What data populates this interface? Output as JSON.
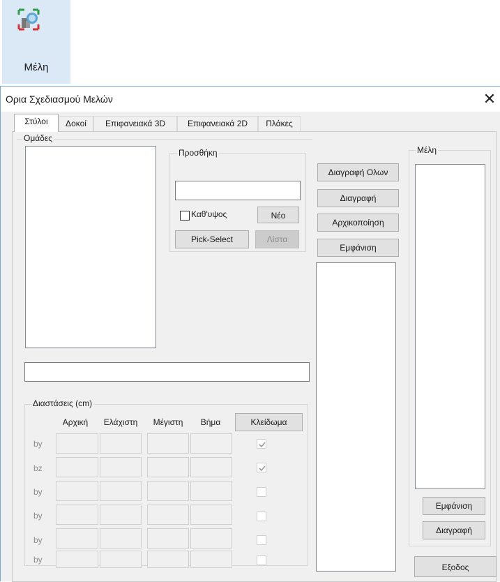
{
  "ribbon": {
    "label": "Μέλη",
    "icon": "members-icon"
  },
  "dialog": {
    "title": "Ορια Σχεδιασμού Μελών",
    "tabs": [
      "Στύλοι",
      "Δοκοί",
      "Επιφανειακά 3D",
      "Επιφανειακά 2D",
      "Πλάκες"
    ],
    "groups_label": "Ομάδες",
    "add_label": "Προσθήκη",
    "add_value": "",
    "by_height_label": "Καθ'υψος",
    "new_button": "Νέο",
    "pick_select_button": "Pick-Select",
    "list_button": "Λίστα",
    "group_name_value": "",
    "delete_all_button": "Διαγραφή Ολων",
    "delete_button": "Διαγραφή",
    "init_button": "Αρχικοποίηση",
    "show_button": "Εμφάνιση",
    "dimensions": {
      "label": "Διαστάσεις (cm)",
      "headers": [
        "Αρχική",
        "Ελάχιστη",
        "Μέγιστη",
        "Βήμα"
      ],
      "lock_button": "Κλείδωμα",
      "rows": [
        {
          "label": "by",
          "checked": true
        },
        {
          "label": "bz",
          "checked": true
        },
        {
          "label": "by",
          "checked": false
        },
        {
          "label": "by",
          "checked": false
        },
        {
          "label": "by",
          "checked": false
        },
        {
          "label": "by",
          "checked": false
        }
      ]
    },
    "members": {
      "label": "Μέλη",
      "show_button": "Εμφάνιση",
      "delete_button": "Διαγραφή"
    },
    "exit_button": "Εξοδος"
  }
}
